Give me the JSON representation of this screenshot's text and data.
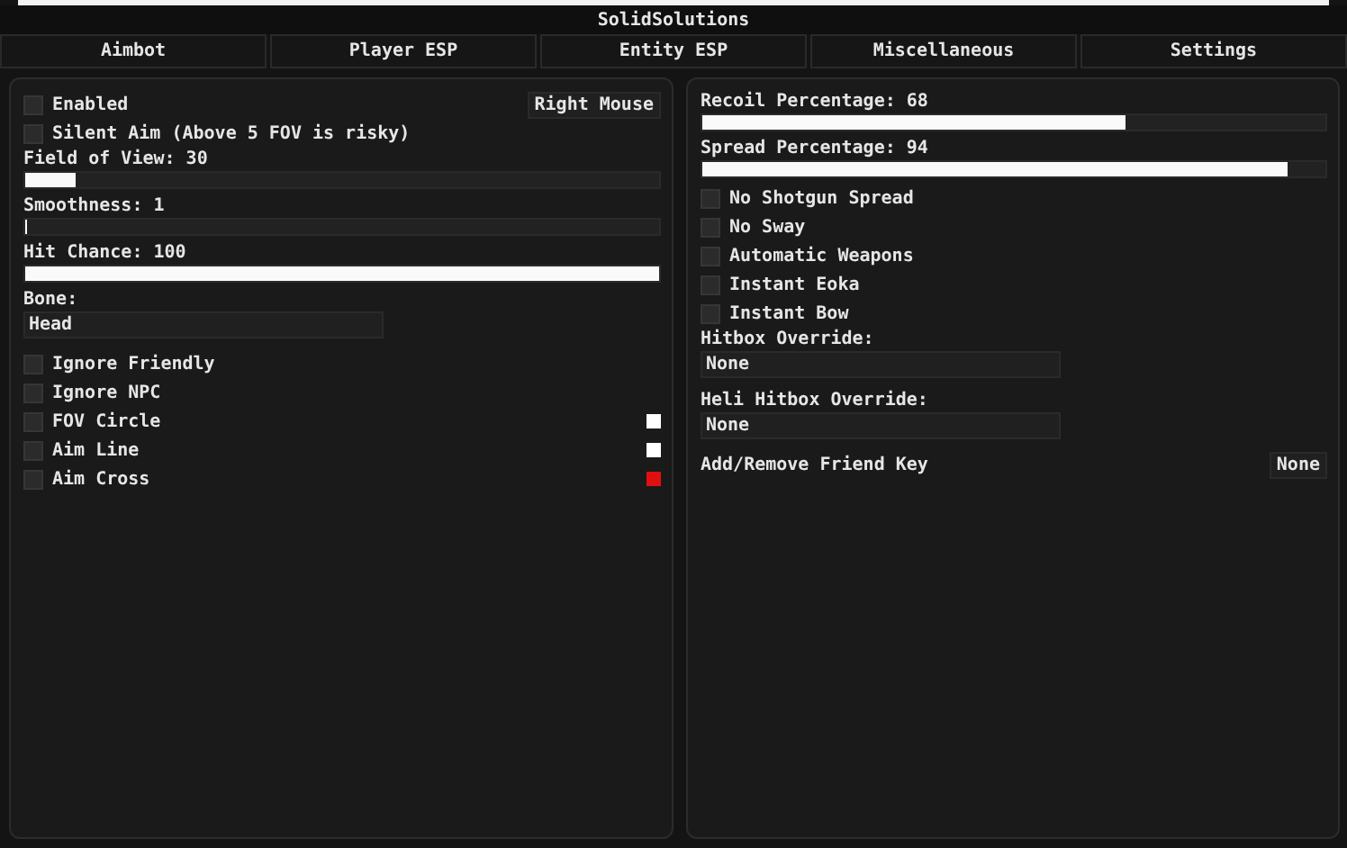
{
  "window": {
    "title": "SolidSolutions"
  },
  "tabs": [
    {
      "label": "Aimbot"
    },
    {
      "label": "Player ESP"
    },
    {
      "label": "Entity ESP"
    },
    {
      "label": "Miscellaneous"
    },
    {
      "label": "Settings"
    }
  ],
  "panels": [
    {
      "items": [
        {
          "kind": "checkbox",
          "label": "Enabled",
          "checked": false,
          "key": "Right Mouse"
        },
        {
          "kind": "checkbox",
          "label": "Silent Aim (Above 5 FOV is risky)",
          "checked": false
        },
        {
          "kind": "slider",
          "label": "Field of View: 30",
          "level": 0.08
        },
        {
          "kind": "slider",
          "label": "Smoothness: 1",
          "level": 0
        },
        {
          "kind": "slider",
          "label": "Hit Chance: 100",
          "level": 1
        },
        {
          "kind": "dropdown",
          "label": "Bone:",
          "value": "Head"
        },
        {
          "kind": "checkbox",
          "label": "Ignore Friendly",
          "checked": false
        },
        {
          "kind": "checkbox",
          "label": "Ignore NPC",
          "checked": false
        },
        {
          "kind": "checkbox",
          "label": "FOV Circle",
          "checked": false,
          "color": "#ffffff"
        },
        {
          "kind": "checkbox",
          "label": "Aim Line",
          "checked": false,
          "color": "#ffffff"
        },
        {
          "kind": "checkbox",
          "label": "Aim Cross",
          "checked": false,
          "color": "#e01010"
        }
      ]
    },
    {
      "items": [
        {
          "kind": "slider",
          "label": "Recoil Percentage: 68",
          "level": 0.68
        },
        {
          "kind": "slider",
          "label": "Spread Percentage: 94",
          "level": 0.94
        },
        {
          "kind": "checkbox",
          "label": "No Shotgun Spread",
          "checked": false
        },
        {
          "kind": "checkbox",
          "label": "No Sway",
          "checked": false
        },
        {
          "kind": "checkbox",
          "label": "Automatic Weapons",
          "checked": false
        },
        {
          "kind": "checkbox",
          "label": "Instant Eoka",
          "checked": false
        },
        {
          "kind": "checkbox",
          "label": "Instant Bow",
          "checked": false
        },
        {
          "kind": "dropdown",
          "label": "Hitbox Override:",
          "value": "None"
        },
        {
          "kind": "dropdown",
          "label": "Heli Hitbox Override:",
          "value": "None"
        },
        {
          "kind": "keybind",
          "label": "Add/Remove Friend Key",
          "key": "None"
        }
      ]
    }
  ]
}
